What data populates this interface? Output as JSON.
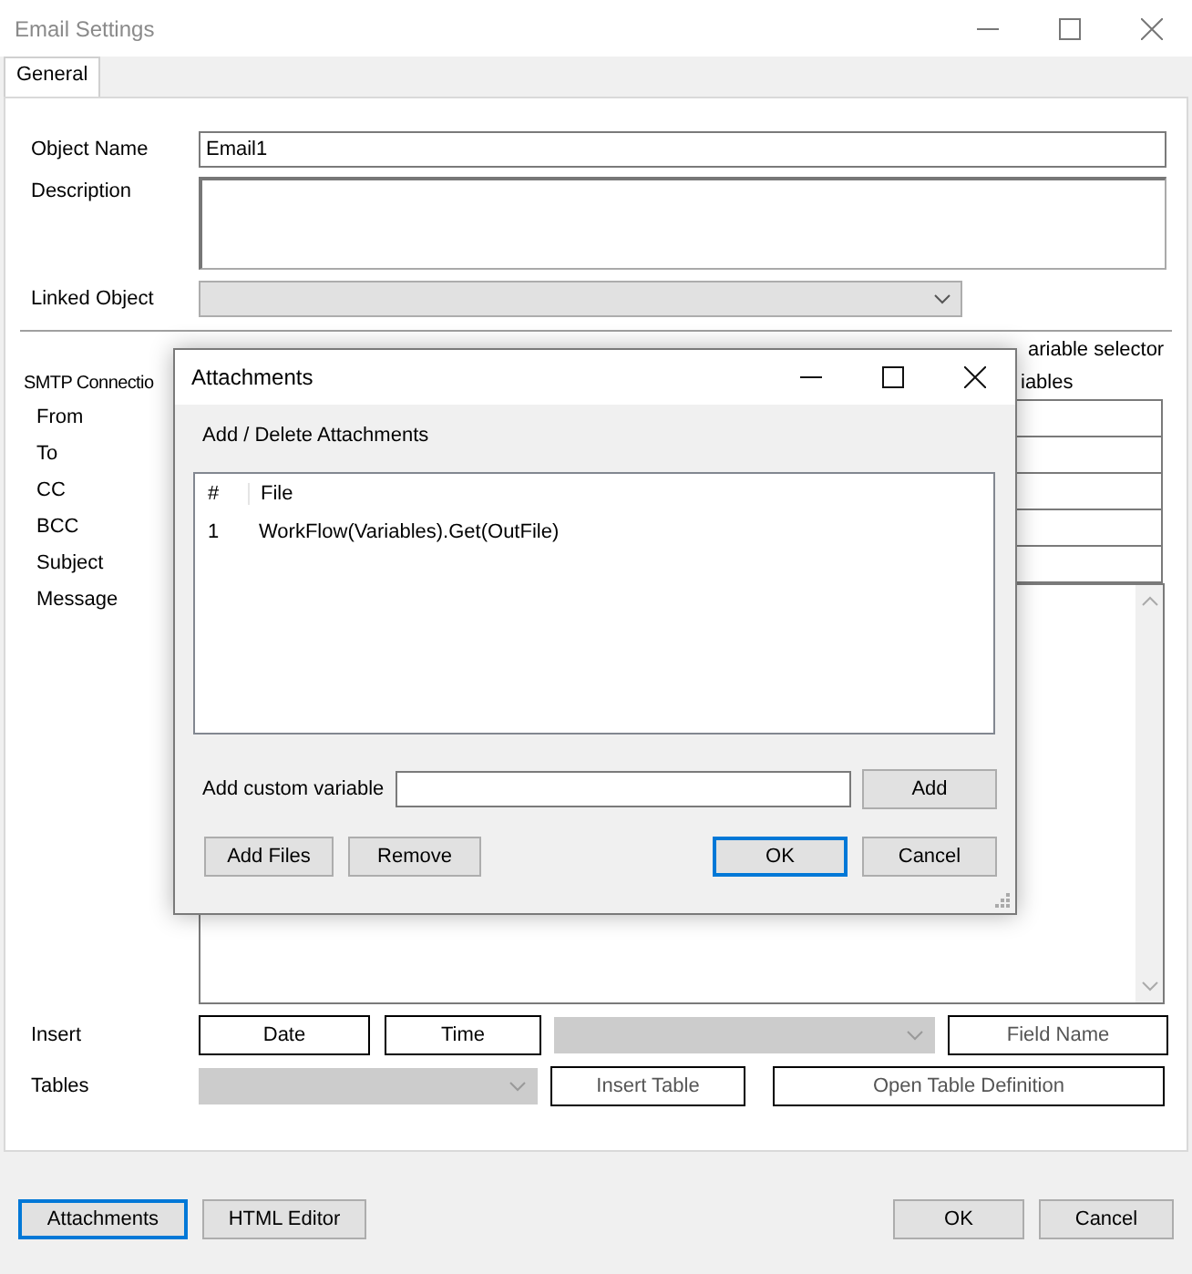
{
  "window": {
    "title": "Email Settings"
  },
  "tabs": [
    {
      "label": "General",
      "selected": true
    }
  ],
  "form": {
    "object_name": {
      "label": "Object Name",
      "value": "Email1"
    },
    "description": {
      "label": "Description"
    },
    "linked_object": {
      "label": "Linked Object",
      "disabled": true
    }
  },
  "smtp": {
    "label": "SMTP Connectio",
    "hint_lines": [
      "ariable selector",
      "iables"
    ],
    "fields": [
      {
        "label": "From"
      },
      {
        "label": "To"
      },
      {
        "label": "CC"
      },
      {
        "label": "BCC"
      },
      {
        "label": "Subject"
      }
    ],
    "message_label": "Message"
  },
  "insert": {
    "label": "Insert",
    "buttons": [
      "Date",
      "Time"
    ],
    "combo_disabled": true,
    "field_name": "Field Name"
  },
  "tables": {
    "label": "Tables",
    "combo_disabled": true,
    "insert_table": "Insert Table",
    "open_definition": "Open Table Definition"
  },
  "footer": {
    "left": [
      {
        "label": "Attachments",
        "focused": true
      },
      {
        "label": "HTML Editor",
        "focused": false
      }
    ],
    "right": [
      {
        "label": "OK",
        "focused": false
      },
      {
        "label": "Cancel",
        "focused": false
      }
    ]
  },
  "dialog": {
    "title": "Attachments",
    "heading": "Add / Delete Attachments",
    "columns": [
      "#",
      "File"
    ],
    "rows": [
      [
        "1",
        "WorkFlow(Variables).Get(OutFile)"
      ]
    ],
    "custom_variable": {
      "label": "Add custom variable",
      "button": "Add"
    },
    "buttons": [
      {
        "label": "Add Files",
        "focused": false
      },
      {
        "label": "Remove",
        "focused": false
      },
      {
        "label": "OK",
        "focused": true
      },
      {
        "label": "Cancel",
        "focused": false
      }
    ]
  }
}
